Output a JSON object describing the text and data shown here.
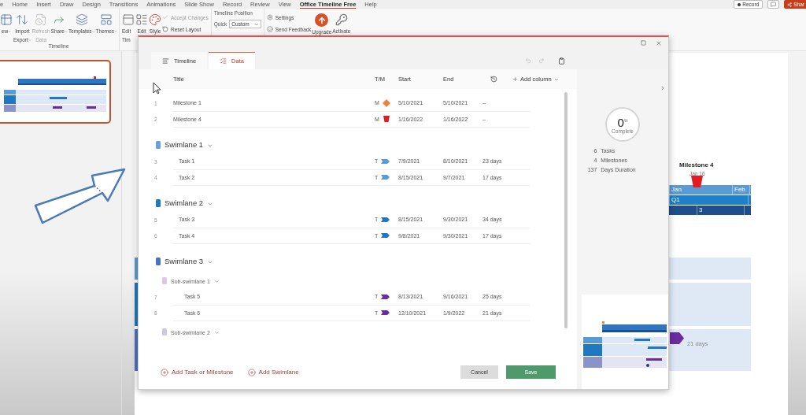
{
  "menu_bar": {
    "tabs": [
      {
        "label": "e",
        "selected": false
      },
      {
        "label": "Home",
        "selected": false
      },
      {
        "label": "Insert",
        "selected": false
      },
      {
        "label": "Draw",
        "selected": false
      },
      {
        "label": "Design",
        "selected": false
      },
      {
        "label": "Transitions",
        "selected": false
      },
      {
        "label": "Animations",
        "selected": false
      },
      {
        "label": "Slide Show",
        "selected": false
      },
      {
        "label": "Record",
        "selected": false
      },
      {
        "label": "Review",
        "selected": false
      },
      {
        "label": "View",
        "selected": false
      },
      {
        "label": "Office Timeline Free",
        "selected": true
      },
      {
        "label": "Help",
        "selected": false
      }
    ],
    "record_button": "Record",
    "share_button": "Shar"
  },
  "ribbon": {
    "timeline_group": {
      "label": "Timeline",
      "buttons": [
        {
          "lines": [
            "ew"
          ],
          "dropdown": true,
          "disabled": false
        },
        {
          "lines": [
            "Import",
            "Export"
          ],
          "dropdown": true,
          "disabled": false
        },
        {
          "lines": [
            "Refresh",
            "Data"
          ],
          "dropdown": false,
          "disabled": true
        },
        {
          "lines": [
            "Share"
          ],
          "dropdown": true,
          "disabled": false
        },
        {
          "lines": [
            "Templates"
          ],
          "dropdown": true,
          "disabled": false
        },
        {
          "lines": [
            "Themes"
          ],
          "dropdown": true,
          "disabled": false
        }
      ]
    },
    "edit_group": {
      "buttons": [
        {
          "lines": [
            "Edit",
            "Tim"
          ],
          "dropdown": false,
          "disabled": false
        },
        {
          "lines": [
            "Edit"
          ],
          "dropdown": false,
          "disabled": false
        },
        {
          "lines": [
            "Style"
          ],
          "dropdown": false,
          "disabled": false
        }
      ],
      "small_buttons": [
        {
          "label": "Accept Changes",
          "disabled": true
        },
        {
          "label": "Reset Layout",
          "disabled": false
        }
      ]
    },
    "position_group": {
      "title": "Timeline Position",
      "quick_label": "Quick",
      "value": "Custom"
    },
    "support_group": {
      "small_buttons": [
        {
          "label": "Settings",
          "disabled": false
        },
        {
          "label": "Send Feedback",
          "disabled": false
        }
      ],
      "buttons": [
        {
          "lines": [
            "Upgrade"
          ],
          "dropdown": false,
          "disabled": false
        },
        {
          "lines": [
            "Activate"
          ],
          "dropdown": false,
          "disabled": false
        }
      ]
    }
  },
  "slide": {
    "milestone": {
      "title": "Milestone 4",
      "date": "Jan 16"
    },
    "months": [
      "Jan",
      "Feb"
    ],
    "quarter": "Q1",
    "week": "3",
    "task_label": "21 days"
  },
  "dialog": {
    "tabs": [
      {
        "label": "Timeline",
        "selected": false
      },
      {
        "label": "Data",
        "selected": true
      }
    ],
    "columns": {
      "title": "Title",
      "type": "T/M",
      "start": "Start",
      "end": "End",
      "add_column": "Add column"
    },
    "items": [
      {
        "kind": "diamond",
        "number": "1",
        "title": "Milestone 1",
        "type": "M",
        "color": "#e8853a",
        "start": "5/10/2021",
        "end": "5/10/2021",
        "duration": "–"
      },
      {
        "kind": "cup",
        "number": "2",
        "title": "Milestone 4",
        "type": "M",
        "color": "#e31b23",
        "start": "1/16/2022",
        "end": "1/16/2022",
        "duration": "–"
      },
      {
        "kind": "swimlane",
        "title": "Swimlane 1",
        "color": "#6a9fd8",
        "expanded": true,
        "children": [
          {
            "kind": "task",
            "number": "3",
            "title": "Task 1",
            "type": "T",
            "color": "#5b9bd5",
            "start": "7/9/2021",
            "end": "8/10/2021",
            "duration": "23 days"
          },
          {
            "kind": "task",
            "number": "4",
            "title": "Task 2",
            "type": "T",
            "color": "#5b9bd5",
            "start": "8/15/2021",
            "end": "9/7/2021",
            "duration": "17 days"
          }
        ]
      },
      {
        "kind": "swimlane",
        "title": "Swimlane 2",
        "color": "#1f78c1",
        "expanded": true,
        "children": [
          {
            "kind": "task",
            "number": "5",
            "title": "Task 3",
            "type": "T",
            "color": "#1f78c1",
            "start": "8/15/2021",
            "end": "9/30/2021",
            "duration": "34 days"
          },
          {
            "kind": "task",
            "number": "6",
            "title": "Task 4",
            "type": "T",
            "color": "#1f78c1",
            "start": "9/8/2021",
            "end": "9/30/2021",
            "duration": "17 days"
          }
        ]
      },
      {
        "kind": "swimlane",
        "title": "Swimlane 3",
        "color": "#4a72c4",
        "expanded": true,
        "children": [
          {
            "kind": "sub_swimlane",
            "title": "Sub-swimlane 1",
            "color": "#d9c8e6",
            "expanded": true,
            "children": [
              {
                "kind": "task",
                "number": "7",
                "title": "Task 5",
                "type": "T",
                "color": "#6a2c9e",
                "start": "8/13/2021",
                "end": "9/16/2021",
                "duration": "25 days"
              },
              {
                "kind": "task",
                "number": "8",
                "title": "Task 6",
                "type": "T",
                "color": "#6a2c9e",
                "start": "12/10/2021",
                "end": "1/9/2022",
                "duration": "21 days"
              }
            ]
          },
          {
            "kind": "sub_swimlane",
            "title": "Sub-swimlane 2",
            "color": "#c9c9e0",
            "expanded": true
          }
        ]
      }
    ],
    "footer": {
      "add_task": "Add Task or Milestone",
      "add_swimlane": "Add Swimlane",
      "cancel": "Cancel",
      "save": "Save"
    },
    "summary": {
      "percent": "0",
      "percent_sign": "%",
      "complete": "Complete",
      "stats": [
        {
          "value": "6",
          "label": "Tasks"
        },
        {
          "value": "4",
          "label": "Milestones"
        },
        {
          "value": "137",
          "label": "Days Duration"
        }
      ]
    }
  }
}
